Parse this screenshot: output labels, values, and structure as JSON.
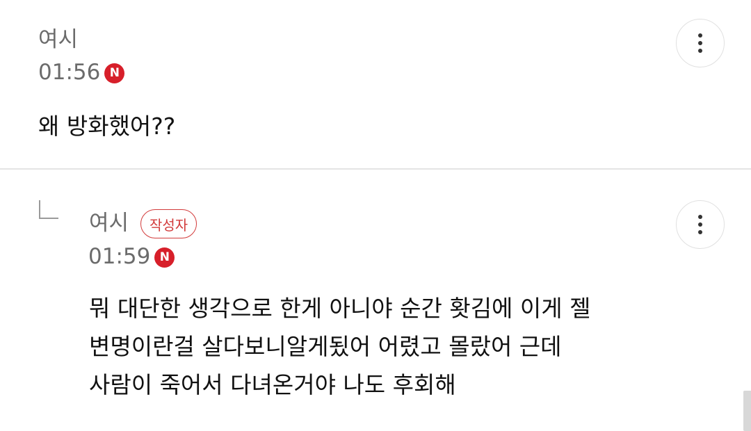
{
  "comments": [
    {
      "author": "여시",
      "time": "01:56",
      "new_badge": "N",
      "body": [
        "왜 방화했어??"
      ]
    },
    {
      "author": "여시",
      "author_badge": "작성자",
      "time": "01:59",
      "new_badge": "N",
      "body": [
        "뭐 대단한 생각으로 한게 아니야 순간 홧김에 이게 젤",
        "변명이란걸 살다보니알게됬어 어렸고 몰랐어 근데",
        "사람이 죽어서 다녀온거야 나도 후회해"
      ]
    }
  ],
  "icons": {
    "more": "more-vertical-icon",
    "reply": "reply-arrow-icon"
  },
  "colors": {
    "badge_red": "#d71f2a",
    "author_badge_red": "#d23a3a",
    "meta_gray": "#6b6b6b",
    "divider": "#e4e4e4"
  }
}
